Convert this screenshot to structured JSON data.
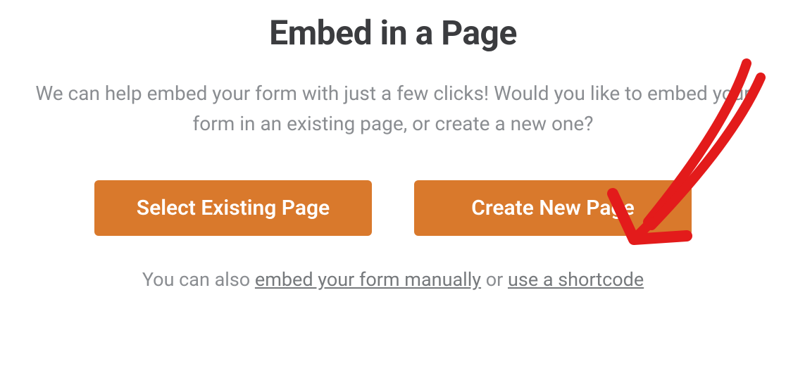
{
  "modal": {
    "title": "Embed in a Page",
    "subtitle": "We can help embed your form with just a few clicks! Would you like to embed your form in an existing page, or create a new one?",
    "buttons": {
      "select_existing": "Select Existing Page",
      "create_new": "Create New Page"
    },
    "footer": {
      "prefix": "You can also ",
      "link_manual": "embed your form manually",
      "middle": " or ",
      "link_shortcode": "use a shortcode"
    }
  },
  "annotation": {
    "type": "hand-drawn-arrow",
    "color": "#e31b1b",
    "points_to": "create-new-page-button"
  }
}
